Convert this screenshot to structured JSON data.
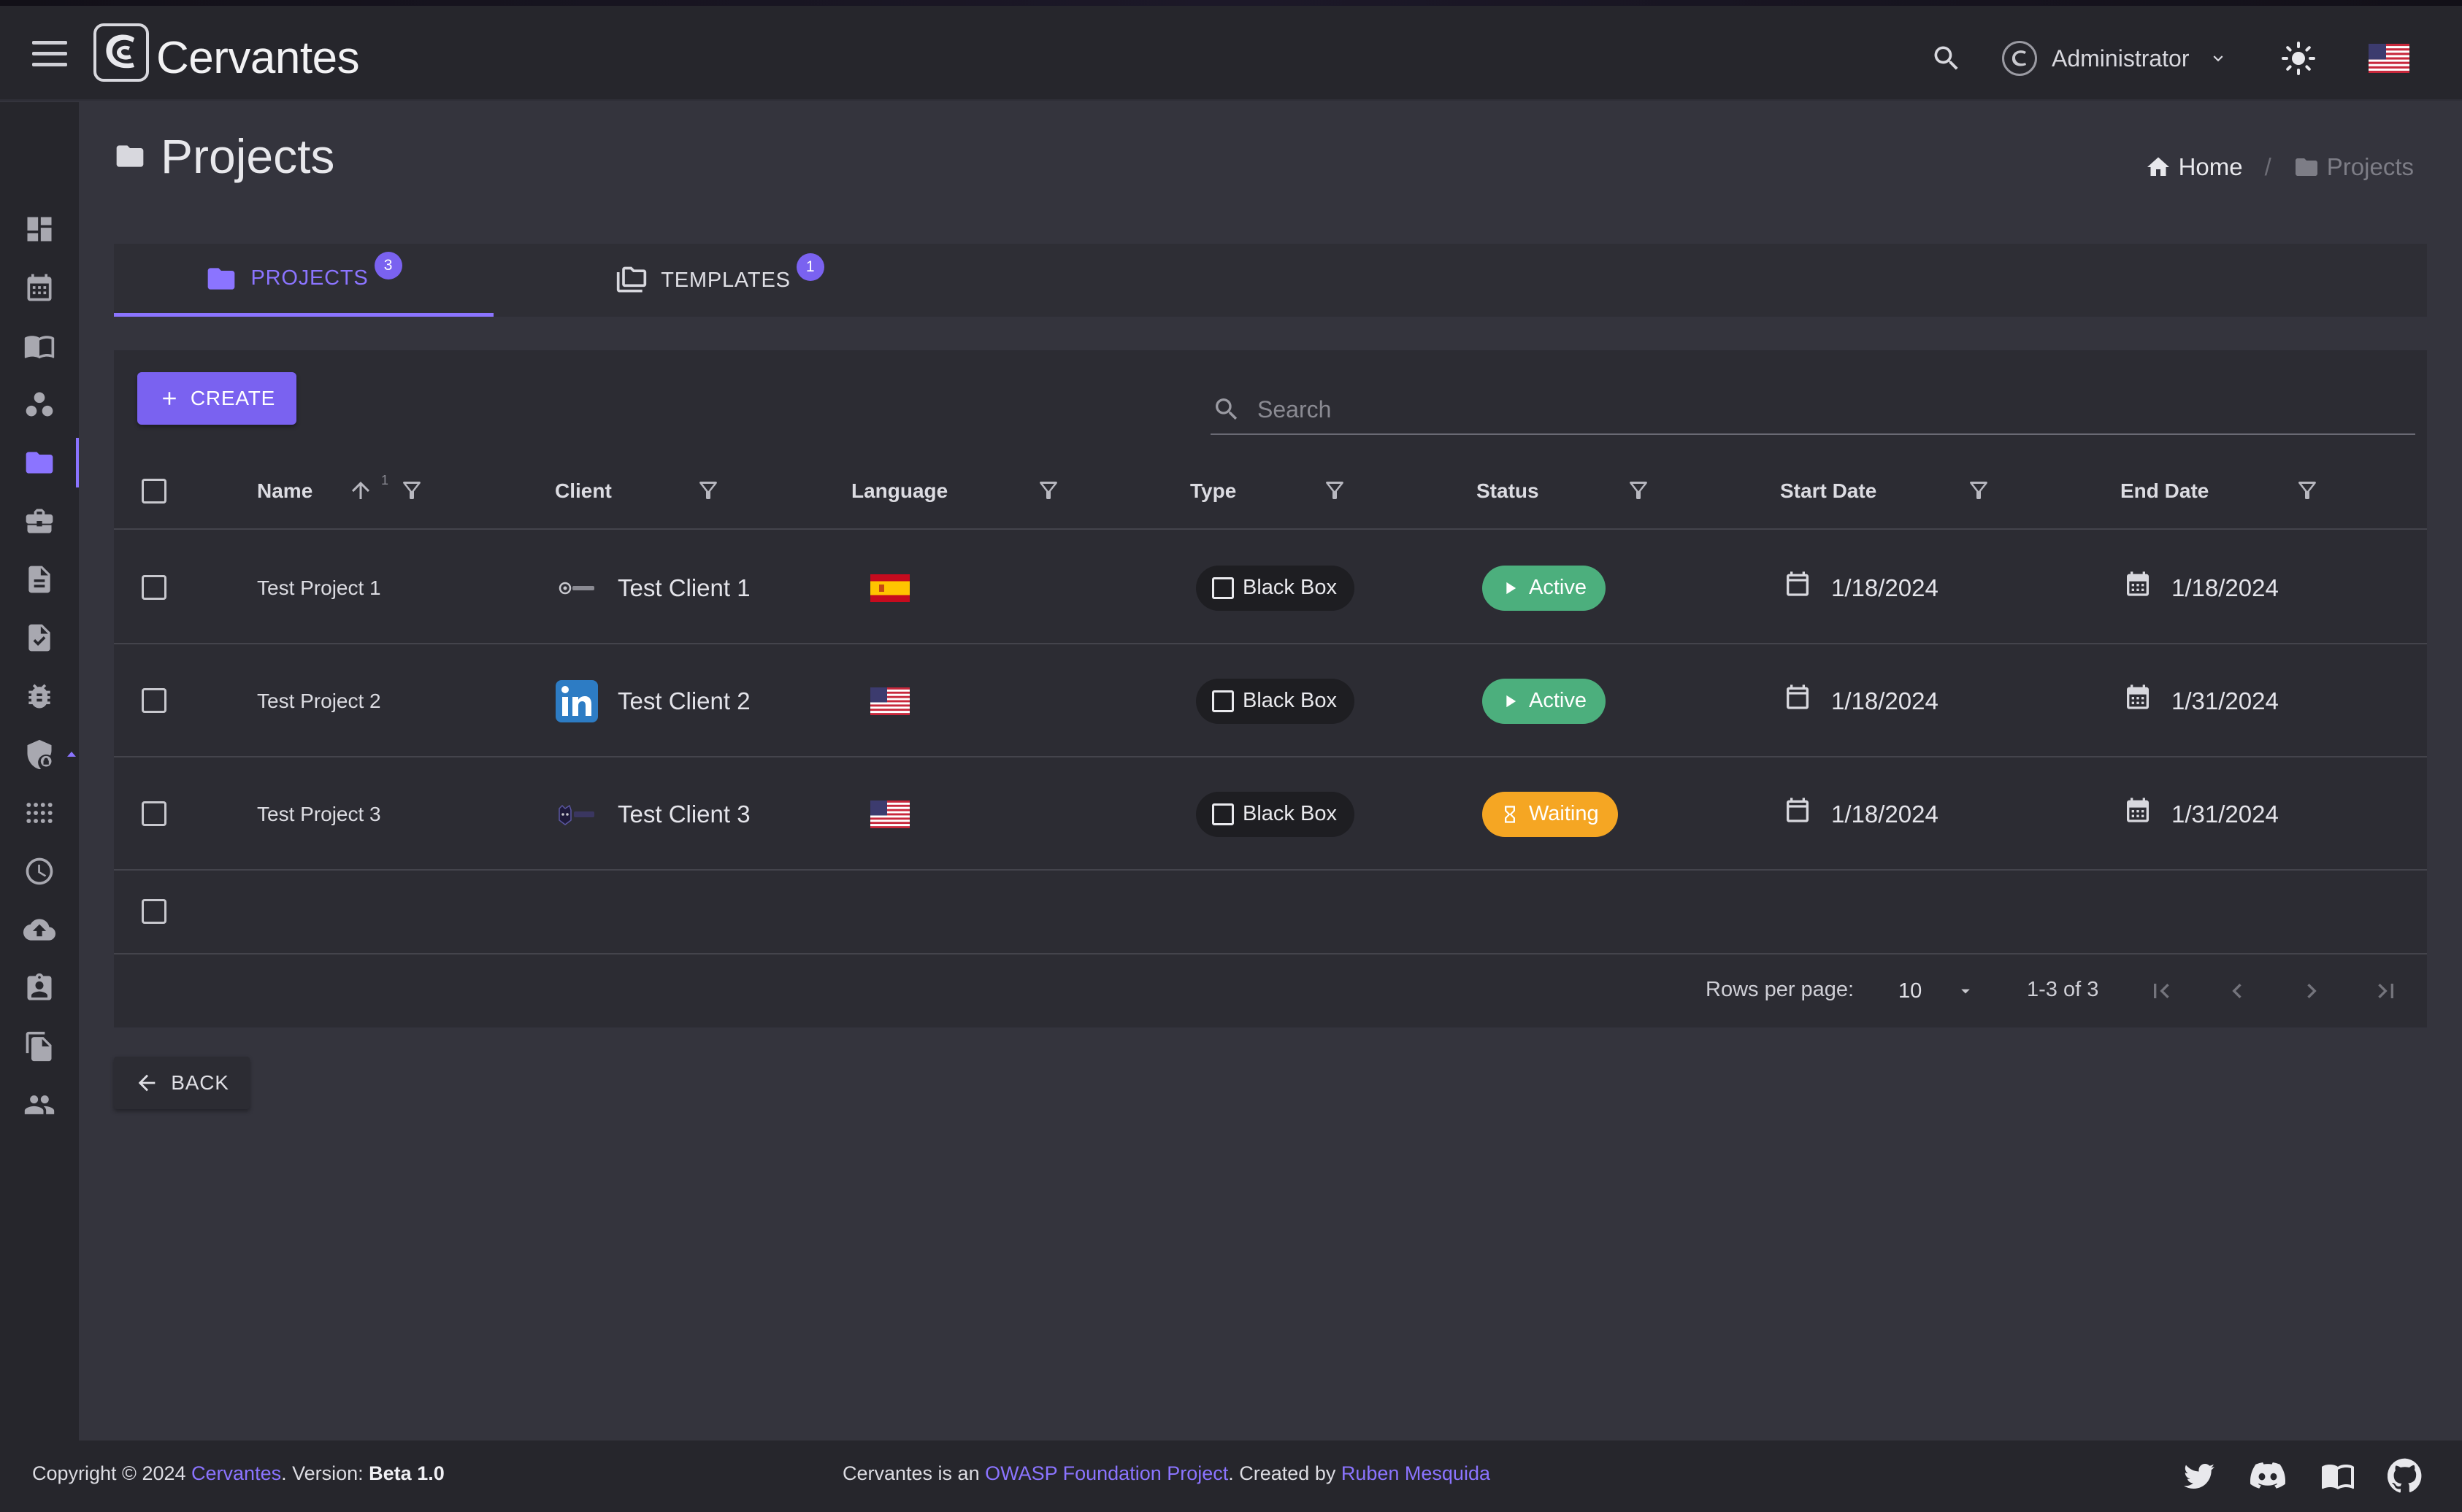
{
  "app": {
    "brand": "Cervantes"
  },
  "header": {
    "user_name": "Administrator",
    "icons": [
      "menu-icon",
      "search-icon",
      "user-avatar-icon",
      "chevron-down-icon",
      "sun-icon",
      "us-flag-icon"
    ]
  },
  "sidebar": {
    "items": [
      {
        "icon": "dashboard-icon",
        "active": false
      },
      {
        "icon": "calendar-icon",
        "active": false
      },
      {
        "icon": "book-icon",
        "active": false
      },
      {
        "icon": "workspaces-icon",
        "active": false
      },
      {
        "icon": "folder-icon",
        "active": true
      },
      {
        "icon": "briefcase-icon",
        "active": false
      },
      {
        "icon": "document-icon",
        "active": false
      },
      {
        "icon": "document-check-icon",
        "active": false
      },
      {
        "icon": "bug-icon",
        "active": false
      },
      {
        "icon": "shield-lock-icon",
        "active": false
      },
      {
        "icon": "apps-grid-icon",
        "active": false
      },
      {
        "icon": "clock-icon",
        "active": false
      },
      {
        "icon": "cloud-upload-icon",
        "active": false
      },
      {
        "icon": "contact-badge-icon",
        "active": false
      },
      {
        "icon": "file-copy-icon",
        "active": false
      },
      {
        "icon": "people-icon",
        "active": false
      }
    ]
  },
  "page": {
    "title": "Projects",
    "breadcrumb": {
      "home": "Home",
      "current": "Projects"
    }
  },
  "tabs": [
    {
      "label": "PROJECTS",
      "count": "3",
      "active": true
    },
    {
      "label": "TEMPLATES",
      "count": "1",
      "active": false
    }
  ],
  "toolbar": {
    "create_label": "CREATE",
    "search_placeholder": "Search"
  },
  "table": {
    "columns": {
      "name": "Name",
      "client": "Client",
      "language": "Language",
      "type": "Type",
      "status": "Status",
      "start_date": "Start Date",
      "end_date": "End Date"
    },
    "sort_index": "1",
    "rows": [
      {
        "name": "Test Project 1",
        "client": "Test Client 1",
        "client_logo": "generic-logo-icon",
        "language_flag": "spain-flag-icon",
        "type": "Black Box",
        "status": "Active",
        "status_color": "#4caf7d",
        "start": "1/18/2024",
        "end": "1/18/2024"
      },
      {
        "name": "Test Project 2",
        "client": "Test Client 2",
        "client_logo": "linkedin-logo-icon",
        "language_flag": "us-flag-icon",
        "type": "Black Box",
        "status": "Active",
        "status_color": "#4caf7d",
        "start": "1/18/2024",
        "end": "1/31/2024"
      },
      {
        "name": "Test Project 3",
        "client": "Test Client 3",
        "client_logo": "snyk-logo-icon",
        "language_flag": "us-flag-icon",
        "type": "Black Box",
        "status": "Waiting",
        "status_color": "#f5a623",
        "start": "1/18/2024",
        "end": "1/31/2024"
      }
    ]
  },
  "pagination": {
    "rows_per_page_label": "Rows per page:",
    "rows_per_page": "10",
    "range": "1-3 of 3"
  },
  "back_label": "BACK",
  "footer": {
    "copyright_prefix": "Copyright © 2024 ",
    "copyright_link": "Cervantes",
    "version_prefix": ". Version: ",
    "version": "Beta 1.0",
    "owasp_prefix": "Cervantes is an ",
    "owasp_link": "OWASP Foundation Project",
    "created_prefix": ". Created by ",
    "author_link": "Ruben Mesquida",
    "social_icons": [
      "twitter-icon",
      "discord-icon",
      "docs-book-icon",
      "github-icon"
    ]
  },
  "colors": {
    "accent": "#7a62f0",
    "active_status": "#4caf7d",
    "waiting_status": "#f5a623",
    "background": "#34343d",
    "surface": "#2c2c33"
  }
}
